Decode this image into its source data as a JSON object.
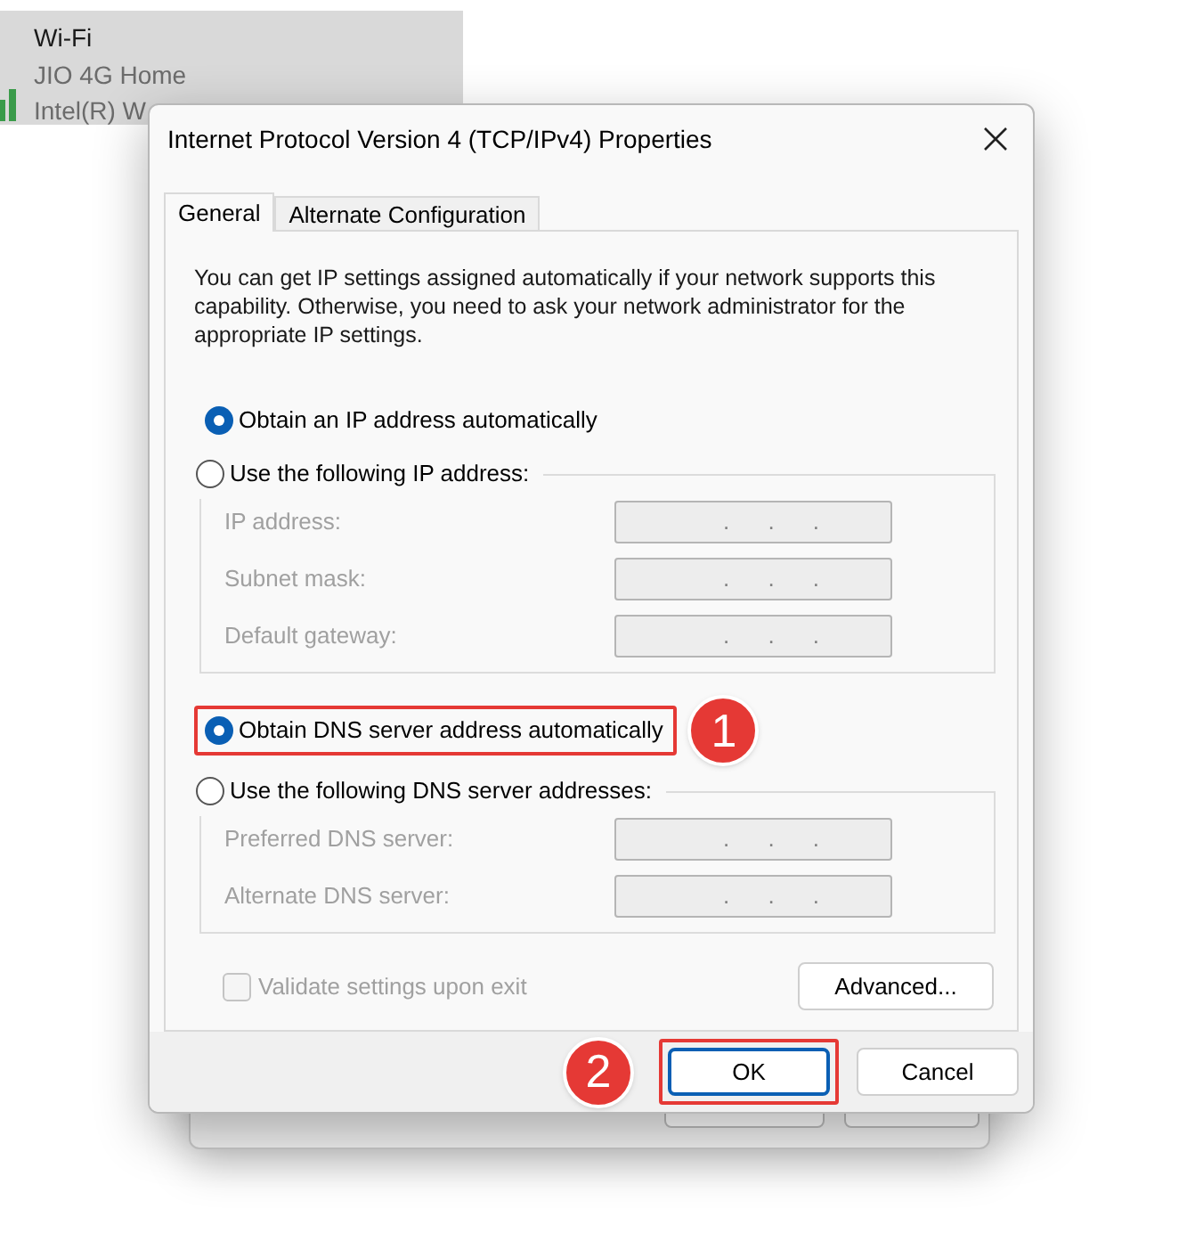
{
  "network_panel": {
    "title": "Wi-Fi",
    "network": "JIO 4G Home",
    "adapter": "Intel(R) W"
  },
  "dialog": {
    "title": "Internet Protocol Version 4 (TCP/IPv4) Properties",
    "tabs": [
      {
        "label": "General",
        "selected": true
      },
      {
        "label": "Alternate Configuration",
        "selected": false
      }
    ],
    "description": "You can get IP settings assigned automatically if your network supports this capability. Otherwise, you need to ask your network administrator for the appropriate IP settings.",
    "sections": [
      {
        "options": [
          {
            "label": "Obtain an IP address automatically",
            "selected": true,
            "highlighted": false
          },
          {
            "label": "Use the following IP address:",
            "selected": false,
            "highlighted": false
          }
        ],
        "fields": [
          {
            "label": "IP address:",
            "value": ". . .",
            "disabled": true
          },
          {
            "label": "Subnet mask:",
            "value": ". . .",
            "disabled": true
          },
          {
            "label": "Default gateway:",
            "value": ". . .",
            "disabled": true
          }
        ]
      },
      {
        "options": [
          {
            "label": "Obtain DNS server address automatically",
            "selected": true,
            "highlighted": true,
            "callout": "1"
          },
          {
            "label": "Use the following DNS server addresses:",
            "selected": false,
            "highlighted": false
          }
        ],
        "fields": [
          {
            "label": "Preferred DNS server:",
            "value": ". . .",
            "disabled": true
          },
          {
            "label": "Alternate DNS server:",
            "value": ". . .",
            "disabled": true
          }
        ]
      }
    ],
    "validate": {
      "label": "Validate settings upon exit",
      "checked": false,
      "disabled": true
    },
    "advanced_button": "Advanced...",
    "buttons": [
      {
        "label": "OK",
        "default": true,
        "highlighted": true,
        "callout": "2"
      },
      {
        "label": "Cancel",
        "default": false,
        "highlighted": false
      }
    ]
  }
}
